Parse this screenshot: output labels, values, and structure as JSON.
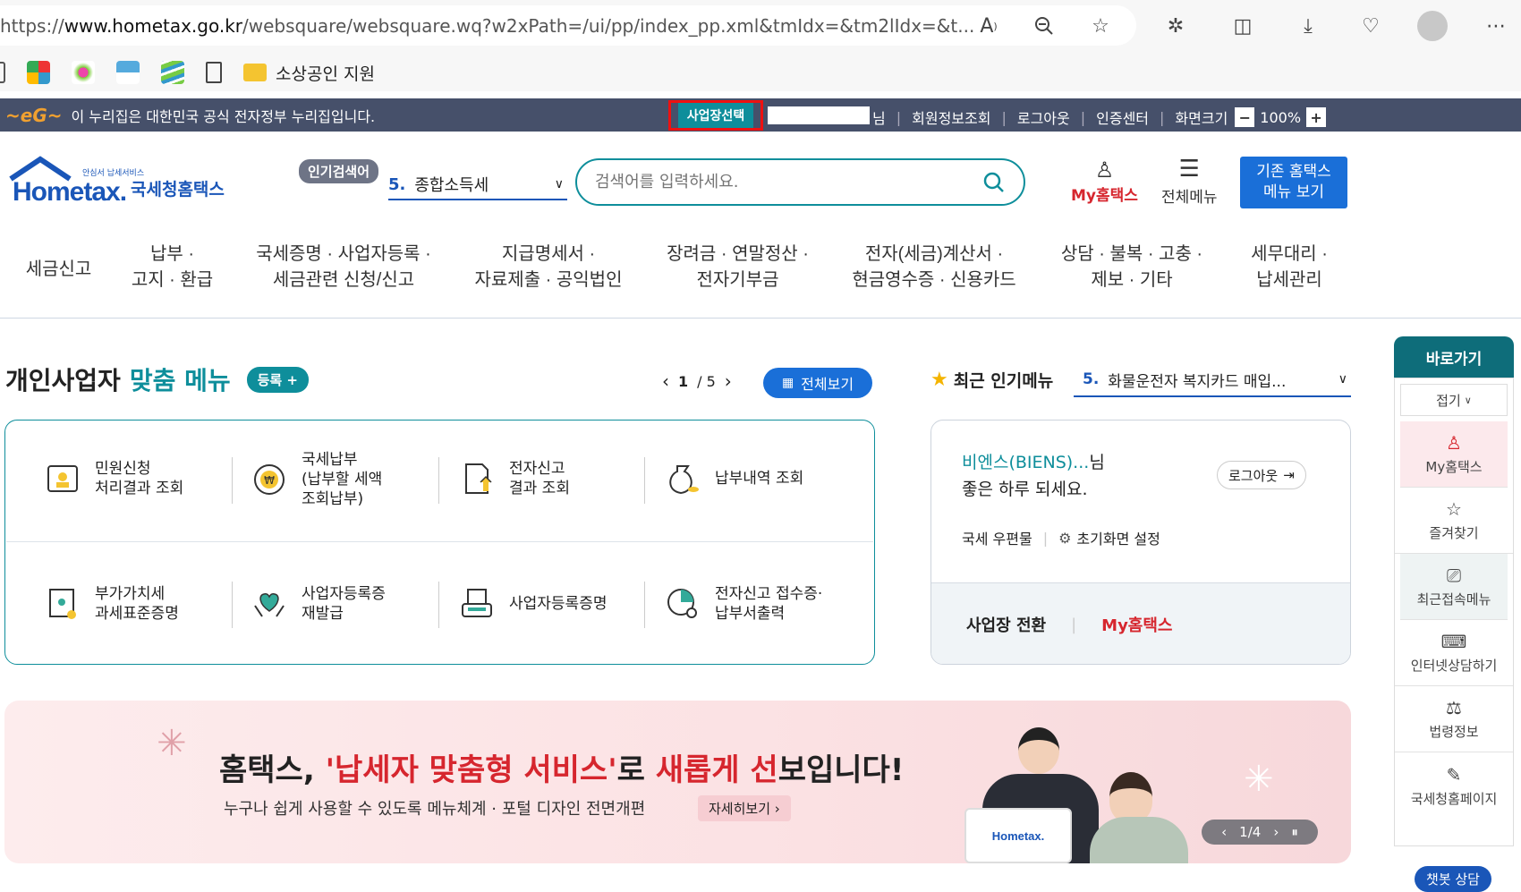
{
  "browser": {
    "url_prefix": "https://",
    "url_host": "www.hometax.go.kr",
    "url_path": "/websquare/websquare.wq?w2xPath=/ui/pp/index_pp.xml&tmIdx=&tm2lIdx=&t...",
    "bookmark_folder": "소상공인 지원"
  },
  "govbar": {
    "notice": "이 누리집은 대한민국 공식 전자정부 누리집입니다.",
    "business_select": "사업장선택",
    "user_suffix": "님",
    "links": [
      "회원정보조회",
      "로그아웃",
      "인증센터"
    ],
    "zoom_label": "화면크기",
    "zoom_value": "100%"
  },
  "header": {
    "logo_small": "안심서 납세서비스",
    "logo_text": "Hometax.",
    "logo_kr": "국세청홈택스",
    "popular_badge": "인기검색어",
    "popular_rank": "5.",
    "popular_term": "종합소득세",
    "search_placeholder": "검색어를 입력하세요.",
    "my_hometax": "My홈택스",
    "all_menu": "전체메뉴",
    "old_menu_line1": "기존 홈택스",
    "old_menu_line2": "메뉴 보기"
  },
  "nav": [
    {
      "l1": "세금신고",
      "l2": ""
    },
    {
      "l1": "납부 ·",
      "l2": "고지 · 환급"
    },
    {
      "l1": "국세증명 · 사업자등록 ·",
      "l2": "세금관련 신청/신고"
    },
    {
      "l1": "지급명세서 ·",
      "l2": "자료제출 · 공익법인"
    },
    {
      "l1": "장려금 · 연말정산 ·",
      "l2": "전자기부금"
    },
    {
      "l1": "전자(세금)계산서 ·",
      "l2": "현금영수증 · 신용카드"
    },
    {
      "l1": "상담 · 불복 · 고충 ·",
      "l2": "제보 · 기타"
    },
    {
      "l1": "세무대리 ·",
      "l2": "납세관리"
    }
  ],
  "custom_menu": {
    "title_a": "개인사업자",
    "title_b": "맞춤 메뉴",
    "register": "등록 +",
    "page_current": "1",
    "page_total": "/ 5",
    "view_all": "전체보기",
    "items": [
      {
        "l1": "민원신청",
        "l2": "처리결과 조회",
        "l3": "",
        "icon": "document-person-icon"
      },
      {
        "l1": "국세납부",
        "l2": "(납부할 세액",
        "l3": "조회납부)",
        "icon": "won-coin-icon"
      },
      {
        "l1": "전자신고",
        "l2": "결과 조회",
        "l3": "",
        "icon": "file-upload-icon"
      },
      {
        "l1": "납부내역 조회",
        "l2": "",
        "l3": "",
        "icon": "money-bag-icon"
      },
      {
        "l1": "부가가치세",
        "l2": "과세표준증명",
        "l3": "",
        "icon": "certificate-icon"
      },
      {
        "l1": "사업자등록증",
        "l2": "재발급",
        "l3": "",
        "icon": "hands-heart-icon"
      },
      {
        "l1": "사업자등록증명",
        "l2": "",
        "l3": "",
        "icon": "printer-icon"
      },
      {
        "l1": "전자신고 접수증·",
        "l2": "납부서출력",
        "l3": "",
        "icon": "pie-search-icon"
      }
    ]
  },
  "popular_menu": {
    "title": "최근 인기메뉴",
    "rank": "5.",
    "item": "화물운전자 복지카드 매입..."
  },
  "user_panel": {
    "name": "비엔스(BIENS)...",
    "name_suffix": "님",
    "greeting": "좋은 하루 되세요.",
    "logout": "로그아웃",
    "mail": "국세 우편물",
    "init_setting": "초기화면 설정",
    "switch_business": "사업장 전환",
    "my_hometax": "My홈택스"
  },
  "banner": {
    "headline_a": "홈택스, ",
    "headline_b": "'납세자 맞춤형 서비스'",
    "headline_c": "로 ",
    "headline_d": "새롭게 선",
    "headline_e": "보입니다!",
    "sub": "누구나 쉽게 사용할 수 있도록 메뉴체계 · 포털 디자인 전면개편",
    "detail_btn": "자세히보기",
    "pager": "1/4",
    "laptop_text": "Hometax."
  },
  "quick": {
    "title": "바로가기",
    "collapse": "접기",
    "items": [
      "My홈택스",
      "즐겨찾기",
      "최근접속메뉴",
      "인터넷상담하기",
      "법령정보",
      "국세청홈페이지"
    ]
  },
  "chatbot": "챗봇 상담",
  "colors": {
    "teal": "#0e8e9b",
    "blue": "#1a6fd8",
    "red": "#d6262e",
    "navy": "#46506a"
  }
}
